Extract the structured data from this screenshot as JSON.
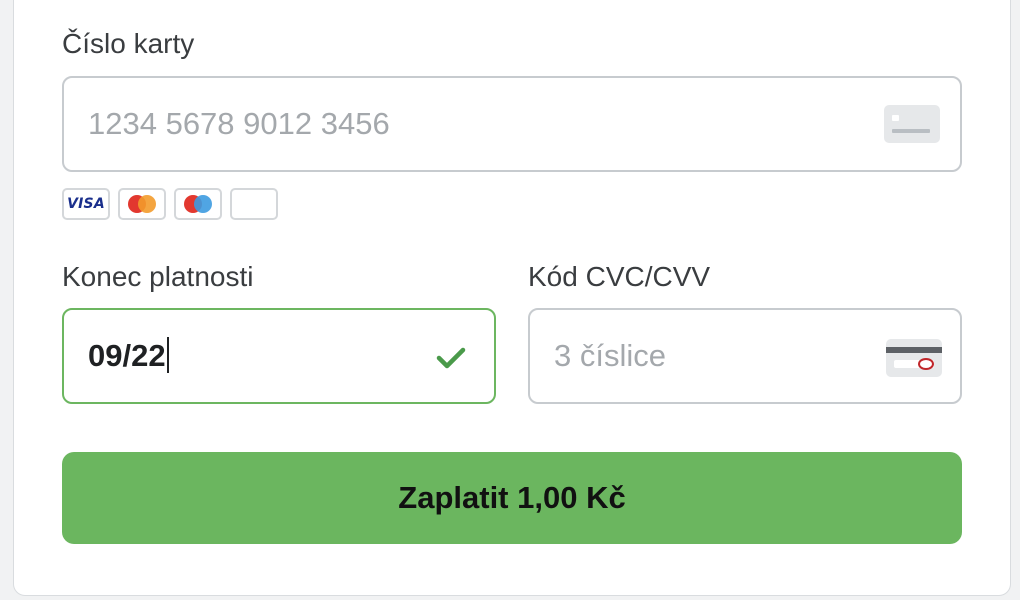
{
  "card_number": {
    "label": "Číslo karty",
    "placeholder": "1234 5678 9012 3456",
    "value": ""
  },
  "card_brands": [
    {
      "name": "visa",
      "text": "VISA"
    },
    {
      "name": "mastercard",
      "text": ""
    },
    {
      "name": "maestro",
      "text": ""
    },
    {
      "name": "generic",
      "text": ""
    }
  ],
  "expiry": {
    "label": "Konec platnosti",
    "value": "09/22",
    "valid": true
  },
  "cvc": {
    "label": "Kód CVC/CVV",
    "placeholder": "3 číslice",
    "value": ""
  },
  "pay_button": {
    "label": "Zaplatit 1,00 Kč"
  },
  "colors": {
    "accent": "#6bb65f",
    "valid_border": "#6cb660",
    "check": "#4a9a4a",
    "visa_blue": "#1a2f8c",
    "mc_red": "#e2382f",
    "mc_orange": "#f39b2b",
    "maestro_blue": "#3d9be0"
  },
  "icons": {
    "card_number": "credit-card-icon",
    "expiry_valid": "checkmark-icon",
    "cvc": "card-back-cvc-icon"
  }
}
